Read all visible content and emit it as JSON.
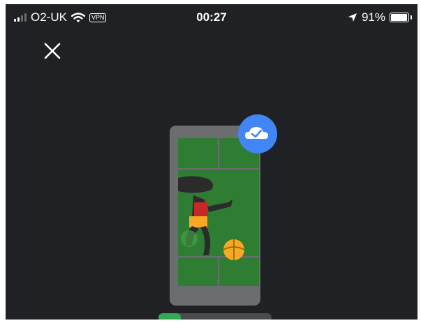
{
  "status_bar": {
    "carrier": "O2-UK",
    "vpn": "VPN",
    "time": "00:27",
    "battery": "91%",
    "battery_level": 0.91,
    "signal_bars_active": 2,
    "signal_bars_total": 4
  },
  "icons": {
    "close": "close-icon",
    "wifi": "wifi-icon",
    "location": "location-arrow-icon",
    "battery": "battery-icon",
    "cloud_done": "cloud-check-icon",
    "phone": "phone-illustration"
  },
  "progress": {
    "value": 0.2
  },
  "colors": {
    "background": "#202124",
    "accent_blue": "#4285f4",
    "progress_green": "#34a853",
    "grass_green": "#2e7d32"
  }
}
